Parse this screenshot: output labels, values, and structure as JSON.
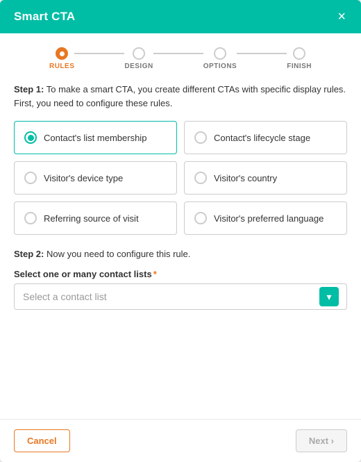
{
  "modal": {
    "title": "Smart CTA",
    "close_label": "×"
  },
  "steps": [
    {
      "label": "RULES",
      "active": true
    },
    {
      "label": "DESIGN",
      "active": false
    },
    {
      "label": "OPTIONS",
      "active": false
    },
    {
      "label": "FINISH",
      "active": false
    }
  ],
  "step1": {
    "desc_prefix": "Step 1:",
    "desc_text": " To make a smart CTA, you create different CTAs with specific display rules. First, you need to configure these rules."
  },
  "rules": [
    {
      "id": "contact-list",
      "label": "Contact's list membership",
      "selected": true
    },
    {
      "id": "lifecycle-stage",
      "label": "Contact's lifecycle stage",
      "selected": false
    },
    {
      "id": "device-type",
      "label": "Visitor's device type",
      "selected": false
    },
    {
      "id": "country",
      "label": "Visitor's country",
      "selected": false
    },
    {
      "id": "referring-source",
      "label": "Referring source of visit",
      "selected": false
    },
    {
      "id": "preferred-language",
      "label": "Visitor's preferred language",
      "selected": false
    }
  ],
  "step2": {
    "desc_prefix": "Step 2:",
    "desc_text": " Now you need to configure this rule."
  },
  "contact_list_field": {
    "label": "Select one or many contact lists",
    "required": true,
    "placeholder": "Select a contact list",
    "options": []
  },
  "footer": {
    "cancel_label": "Cancel",
    "next_label": "Next ›"
  }
}
